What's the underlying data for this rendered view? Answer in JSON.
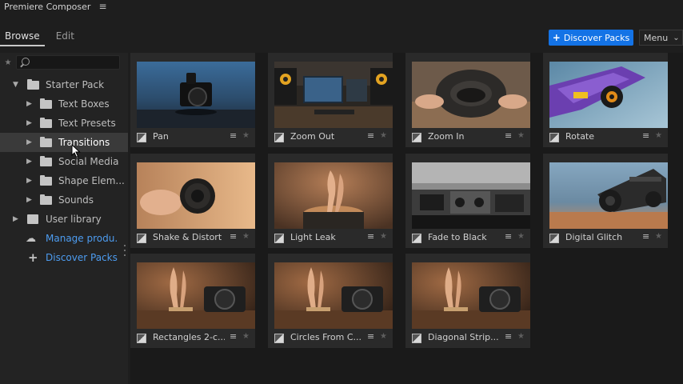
{
  "app": {
    "title": "Premiere Composer"
  },
  "tabs": [
    {
      "label": "Browse"
    },
    {
      "label": "Edit"
    }
  ],
  "header": {
    "discover_label": "Discover Packs",
    "menu_label": "Menu"
  },
  "search": {
    "value": "",
    "placeholder": ""
  },
  "sidebar": {
    "items": [
      {
        "label": "Starter Pack"
      },
      {
        "label": "Text Boxes"
      },
      {
        "label": "Text Presets"
      },
      {
        "label": "Transitions"
      },
      {
        "label": "Social Media"
      },
      {
        "label": "Shape Elem..."
      },
      {
        "label": "Sounds"
      },
      {
        "label": "User library"
      },
      {
        "label": "Manage produ..."
      },
      {
        "label": "Discover Packs"
      }
    ]
  },
  "cards": [
    {
      "name": "Pan"
    },
    {
      "name": "Zoom Out"
    },
    {
      "name": "Zoom In"
    },
    {
      "name": "Rotate"
    },
    {
      "name": "Shake & Distort"
    },
    {
      "name": "Light Leak"
    },
    {
      "name": "Fade to Black"
    },
    {
      "name": "Digital Glitch"
    },
    {
      "name": "Rectangles 2-c..."
    },
    {
      "name": "Circles From C..."
    },
    {
      "name": "Diagonal Strip..."
    }
  ],
  "colors": {
    "accent": "#1473e6",
    "link": "#4d9cf0",
    "selected_row": "#3a3a3a"
  }
}
